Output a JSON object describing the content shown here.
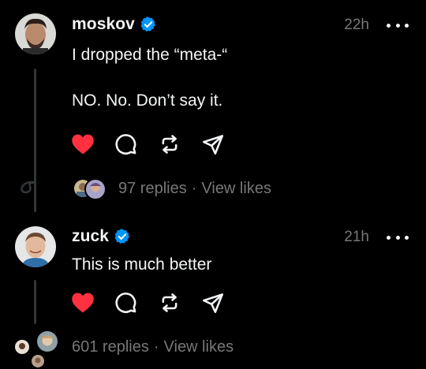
{
  "posts": [
    {
      "username": "moskov",
      "verified": true,
      "timestamp": "22h",
      "text": "I dropped the “meta-“\n\nNO. No. Don’t say it.",
      "liked": true,
      "replies": "97 replies",
      "separator": "·",
      "view_likes": "View likes"
    },
    {
      "username": "zuck",
      "verified": true,
      "timestamp": "21h",
      "text": "This is much better",
      "liked": true,
      "replies": "601 replies",
      "separator": "·",
      "view_likes": "View likes"
    }
  ],
  "colors": {
    "background": "#000000",
    "like": "#ff3040",
    "verified": "#0095f6",
    "muted": "#777777",
    "text": "#f3f5f7"
  },
  "icons": {
    "like": "heart-icon",
    "comment": "comment-icon",
    "repost": "repost-icon",
    "share": "share-icon",
    "more": "more-icon",
    "verified": "verified-badge-icon"
  }
}
